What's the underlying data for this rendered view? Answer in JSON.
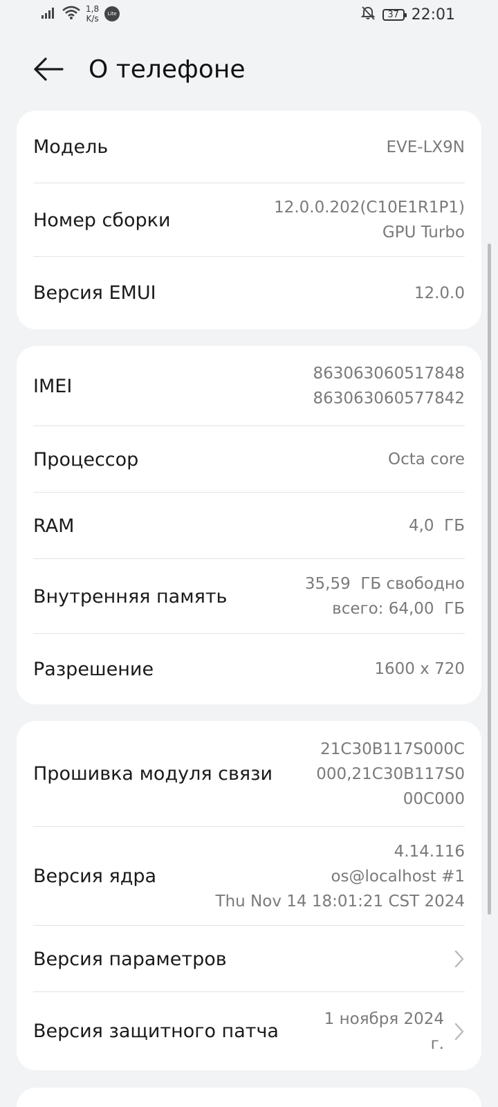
{
  "status_bar": {
    "speed_value": "1,8",
    "speed_unit": "K/s",
    "lite_badge": "Lite",
    "battery": "37",
    "time": "22:01"
  },
  "header": {
    "title": "О телефоне"
  },
  "cards": [
    {
      "rows": [
        {
          "label": "Модель",
          "value": [
            "EVE-LX9N"
          ]
        },
        {
          "label": "Номер сборки",
          "value": [
            "12.0.0.202(C10E1R1P1)",
            "GPU Turbo"
          ]
        },
        {
          "label": "Версия EMUI",
          "value": [
            "12.0.0"
          ]
        }
      ]
    },
    {
      "rows": [
        {
          "label": "IMEI",
          "value": [
            "863063060517848",
            "863063060577842"
          ]
        },
        {
          "label": "Процессор",
          "value": [
            "Octa core"
          ]
        },
        {
          "label": "RAM",
          "value": [
            "4,0  ГБ"
          ]
        },
        {
          "label": "Внутренняя память",
          "value": [
            "35,59  ГБ свободно",
            "всего: 64,00  ГБ"
          ]
        },
        {
          "label": "Разрешение",
          "value": [
            "1600 x 720"
          ]
        }
      ]
    },
    {
      "rows": [
        {
          "label": "Прошивка модуля связи",
          "value": [
            "21C30B117S000C",
            "000,21C30B117S0",
            "00C000"
          ]
        },
        {
          "label": "Версия ядра",
          "value": [
            "4.14.116",
            "os@localhost #1",
            "Thu Nov 14 18:01:21 CST 2024"
          ]
        },
        {
          "label": "Версия параметров",
          "value": []
        },
        {
          "label": "Версия защитного патча",
          "value": [
            "1 ноября 2024",
            "г."
          ]
        }
      ]
    }
  ]
}
